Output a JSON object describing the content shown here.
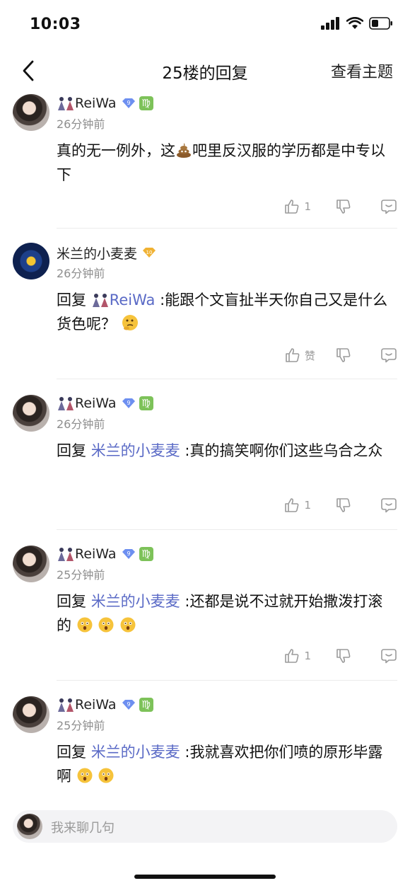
{
  "status_bar": {
    "time": "10:03"
  },
  "nav": {
    "title": "25楼的回复",
    "action": "查看主题"
  },
  "replies": [
    {
      "user": "ReiWa",
      "level": "9",
      "sign": "♍",
      "time": "26分钟前",
      "text_before": "真的无一例外，这",
      "text_after": "吧里反汉服的学历都是中专以下",
      "like_count": "1"
    },
    {
      "user": "米兰的小麦麦",
      "level": "10",
      "time": "26分钟前",
      "reply_prefix": "回复",
      "mention": "ReiWa",
      "text": " :能跟个文盲扯半天你自己又是什么货色呢？",
      "like_label": "赞"
    },
    {
      "user": "ReiWa",
      "level": "9",
      "sign": "♍",
      "time": "26分钟前",
      "reply_prefix": "回复",
      "mention": "米兰的小麦麦",
      "text": " :真的搞笑啊你们这些乌合之众",
      "like_count": "1"
    },
    {
      "user": "ReiWa",
      "level": "9",
      "sign": "♍",
      "time": "25分钟前",
      "reply_prefix": "回复",
      "mention": "米兰的小麦麦",
      "text": " :还都是说不过就开始撒泼打滚的",
      "like_count": "1"
    },
    {
      "user": "ReiWa",
      "level": "9",
      "sign": "♍",
      "time": "25分钟前",
      "reply_prefix": "回复",
      "mention": "米兰的小麦麦",
      "text": " :我就喜欢把你们喷的原形毕露啊"
    }
  ],
  "input": {
    "placeholder": "我来聊几句"
  },
  "colors": {
    "mention": "#5a6ac6",
    "level_blue": "#6d8ff0",
    "level_gold": "#f0b233",
    "virgo_green": "#7dc259"
  }
}
